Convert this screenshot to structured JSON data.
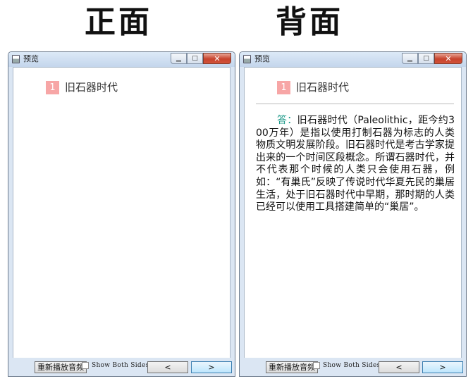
{
  "headings": {
    "front": "正面",
    "back": "背面"
  },
  "front_window": {
    "title": "预览",
    "card_number": "1",
    "card_title": "旧石器时代",
    "replay_button": "重新播放音频",
    "show_both_sides": "Show Both Sides",
    "prev_label": "<",
    "next_label": ">"
  },
  "back_window": {
    "title": "预览",
    "card_number": "1",
    "card_title": "旧石器时代",
    "answer_label": "答：",
    "answer_text": "旧石器时代（Paleolithic，距今约300万年）是指以使用打制石器为标志的人类物质文明发展阶段。旧石器时代是考古学家提出来的一个时间区段概念。所谓石器时代，并不代表那个时候的人类只会使用石器，例如：“有巢氏”反映了传说时代华夏先民的巢居生活，处于旧石器时代中早期，那时期的人类已经可以使用工具搭建简单的“巢居”。",
    "replay_button": "重新播放音频",
    "show_both_sides": "Show Both Sides",
    "prev_label": "<",
    "next_label": ">"
  },
  "icons": {
    "app": "preview-app-icon",
    "minimize": "minimize-icon",
    "maximize": "maximize-icon",
    "close": "close-icon"
  },
  "colors": {
    "badge": "#f7a6a6",
    "answer_label": "#1f9a8a",
    "window_frame": "#dbe6f3",
    "close_button": "#c7432d"
  }
}
